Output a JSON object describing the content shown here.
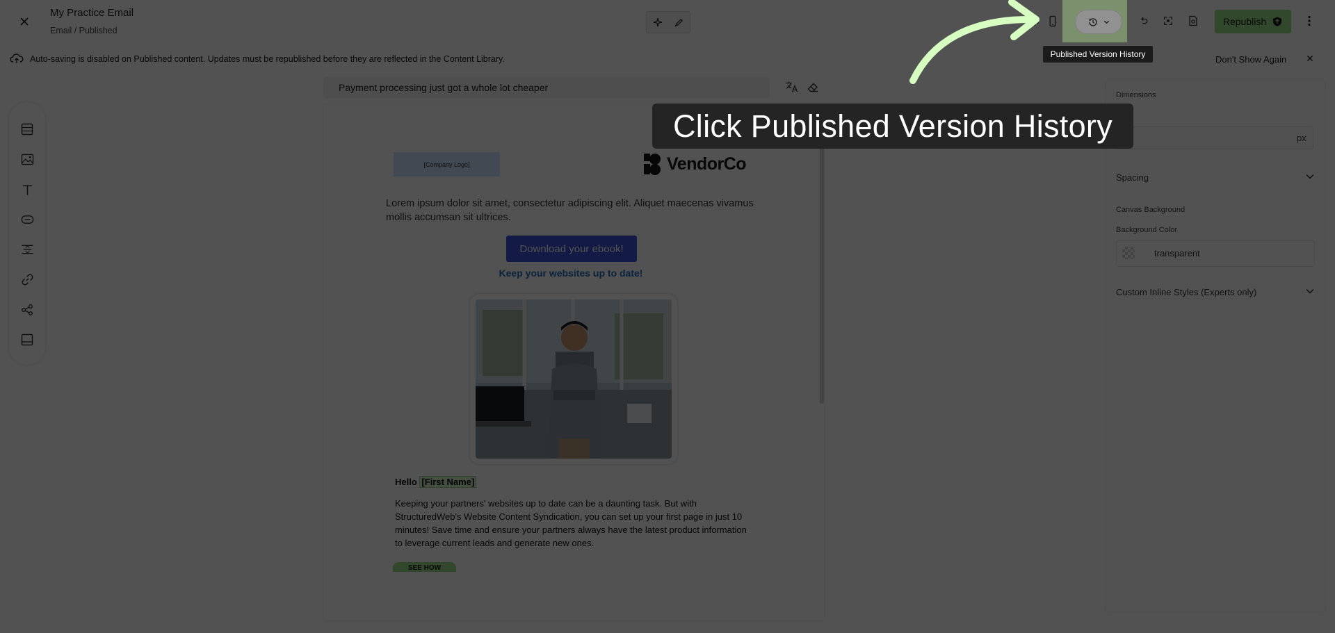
{
  "header": {
    "title": "My Practice Email",
    "breadcrumb": "Email / Published",
    "republish_label": "Republish",
    "tooltip": "Published Version History"
  },
  "notice": {
    "text": "Auto-saving is disabled on Published content. Updates must be republished before they are reflected in the Content Library.",
    "dismiss_label": "Don't Show Again"
  },
  "subject": {
    "text": "Payment processing just got a whole lot cheaper"
  },
  "email": {
    "logo_placeholder": "[Company Logo]",
    "brand_name": "VendorCo",
    "intro": "Lorem ipsum dolor sit amet, consectetur adipiscing elit. Aliquet maecenas vivamus mollis accumsan sit ultrices.",
    "cta_label": "Download your ebook!",
    "link_label": "Keep your websites up to date!",
    "greeting": "Hello",
    "merge_tag": "[First Name]",
    "body": "Keeping your partners' websites up to date can be a daunting task. But with StructuredWeb's Website Content Syndication, you can set up your first page in just 10 minutes! Save time and ensure your partners always have the latest product information to leverage current leads and generate new ones.",
    "secondary_cta": "SEE HOW"
  },
  "right_panel": {
    "dimensions_label": "Dimensions",
    "unit": "px",
    "spacing_label": "Spacing",
    "canvas_bg_label": "Canvas Background",
    "bg_color_label": "Background Color",
    "bg_color_value": "transparent",
    "custom_styles_label": "Custom Inline Styles (Experts only)"
  },
  "guide": {
    "callout": "Click Published Version History"
  },
  "colors": {
    "accent_green": "#9be08a",
    "highlight": "#d8ffc2",
    "cta_blue": "#3a51d6",
    "link_blue": "#1e6fbf"
  }
}
